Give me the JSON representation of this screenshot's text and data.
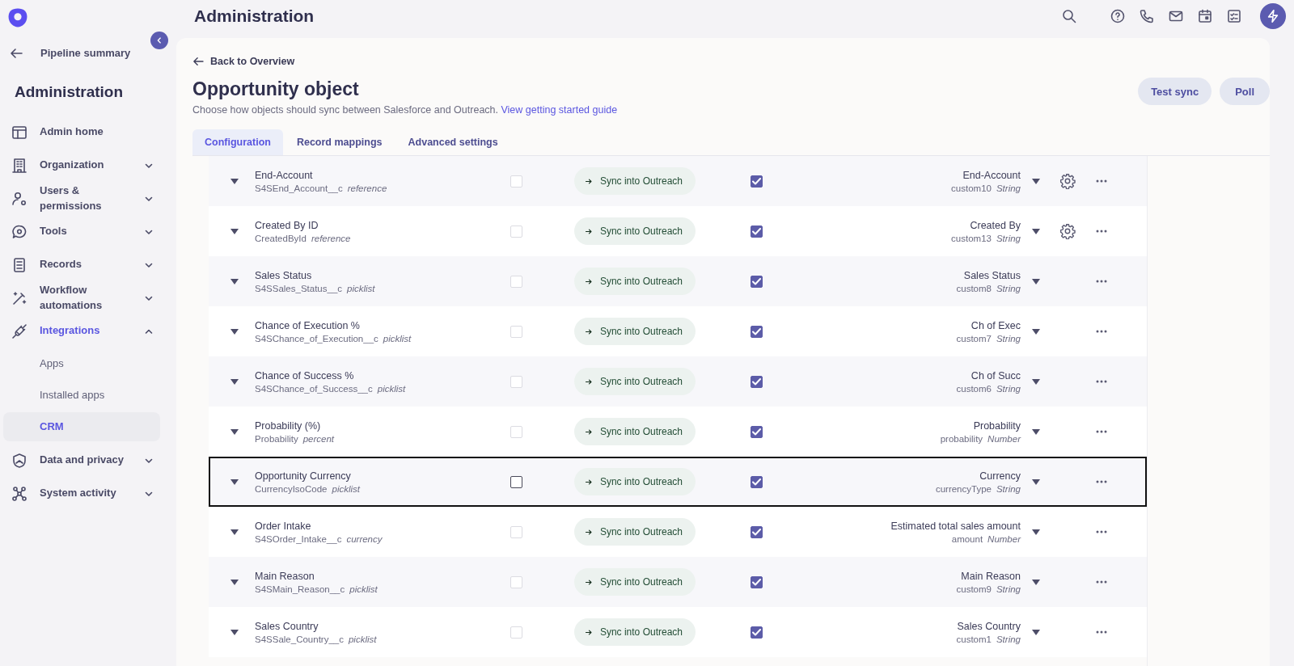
{
  "sidebar": {
    "back_label": "Pipeline summary",
    "title": "Administration",
    "items": [
      {
        "label": "Admin home"
      },
      {
        "label": "Organization",
        "expanded": false
      },
      {
        "label": "Users & permissions",
        "expanded": false
      },
      {
        "label": "Tools",
        "expanded": false
      },
      {
        "label": "Records",
        "expanded": false
      },
      {
        "label": "Workflow automations",
        "expanded": false
      },
      {
        "label": "Integrations",
        "expanded": true,
        "children": [
          {
            "label": "Apps",
            "selected": false
          },
          {
            "label": "Installed apps",
            "selected": false
          },
          {
            "label": "CRM",
            "selected": true
          }
        ]
      },
      {
        "label": "Data and privacy",
        "expanded": false
      },
      {
        "label": "System activity",
        "expanded": false
      }
    ]
  },
  "header": {
    "title": "Administration"
  },
  "page": {
    "back_link": "Back to Overview",
    "title": "Opportunity object",
    "subtitle": "Choose how objects should sync between Salesforce and Outreach.",
    "guide_link": "View getting started guide",
    "buttons": [
      "Test sync",
      "Poll"
    ]
  },
  "tabs": [
    {
      "label": "Configuration",
      "selected": true
    },
    {
      "label": "Record mappings",
      "selected": false
    },
    {
      "label": "Advanced settings",
      "selected": false
    }
  ],
  "rows": [
    {
      "name": "End-Account",
      "api_name": "S4SEnd_Account__c",
      "type": "reference",
      "source_checked": false,
      "source_disabled": true,
      "sync": "Sync into Outreach",
      "target_checked": true,
      "target_name": "End-Account",
      "target_field": "custom10",
      "target_type": "String",
      "settings": true,
      "highlighted": false
    },
    {
      "name": "Created By ID",
      "api_name": "CreatedById",
      "type": "reference",
      "source_checked": false,
      "source_disabled": true,
      "sync": "Sync into Outreach",
      "target_checked": true,
      "target_name": "Created By",
      "target_field": "custom13",
      "target_type": "String",
      "settings": true,
      "highlighted": false
    },
    {
      "name": "Sales Status",
      "api_name": "S4SSales_Status__c",
      "type": "picklist",
      "source_checked": false,
      "source_disabled": true,
      "sync": "Sync into Outreach",
      "target_checked": true,
      "target_name": "Sales Status",
      "target_field": "custom8",
      "target_type": "String",
      "settings": false,
      "highlighted": false
    },
    {
      "name": "Chance of Execution %",
      "api_name": "S4SChance_of_Execution__c",
      "type": "picklist",
      "source_checked": false,
      "source_disabled": true,
      "sync": "Sync into Outreach",
      "target_checked": true,
      "target_name": "Ch of Exec",
      "target_field": "custom7",
      "target_type": "String",
      "settings": false,
      "highlighted": false
    },
    {
      "name": "Chance of Success %",
      "api_name": "S4SChance_of_Success__c",
      "type": "picklist",
      "source_checked": false,
      "source_disabled": true,
      "sync": "Sync into Outreach",
      "target_checked": true,
      "target_name": "Ch of Succ",
      "target_field": "custom6",
      "target_type": "String",
      "settings": false,
      "highlighted": false
    },
    {
      "name": "Probability (%)",
      "api_name": "Probability",
      "type": "percent",
      "source_checked": false,
      "source_disabled": true,
      "sync": "Sync into Outreach",
      "target_checked": true,
      "target_name": "Probability",
      "target_field": "probability",
      "target_type": "Number",
      "settings": false,
      "highlighted": false
    },
    {
      "name": "Opportunity Currency",
      "api_name": "CurrencyIsoCode",
      "type": "picklist",
      "source_checked": false,
      "source_disabled": false,
      "sync": "Sync into Outreach",
      "target_checked": true,
      "target_name": "Currency",
      "target_field": "currencyType",
      "target_type": "String",
      "settings": false,
      "highlighted": true
    },
    {
      "name": "Order Intake",
      "api_name": "S4SOrder_Intake__c",
      "type": "currency",
      "source_checked": false,
      "source_disabled": true,
      "sync": "Sync into Outreach",
      "target_checked": true,
      "target_name": "Estimated total sales amount",
      "target_field": "amount",
      "target_type": "Number",
      "settings": false,
      "highlighted": false
    },
    {
      "name": "Main Reason",
      "api_name": "S4SMain_Reason__c",
      "type": "picklist",
      "source_checked": false,
      "source_disabled": true,
      "sync": "Sync into Outreach",
      "target_checked": true,
      "target_name": "Main Reason",
      "target_field": "custom9",
      "target_type": "String",
      "settings": false,
      "highlighted": false
    },
    {
      "name": "Sales Country",
      "api_name": "S4SSale_Country__c",
      "type": "picklist",
      "source_checked": false,
      "source_disabled": true,
      "sync": "Sync into Outreach",
      "target_checked": true,
      "target_name": "Sales Country",
      "target_field": "custom1",
      "target_type": "String",
      "settings": false,
      "highlighted": false
    }
  ]
}
